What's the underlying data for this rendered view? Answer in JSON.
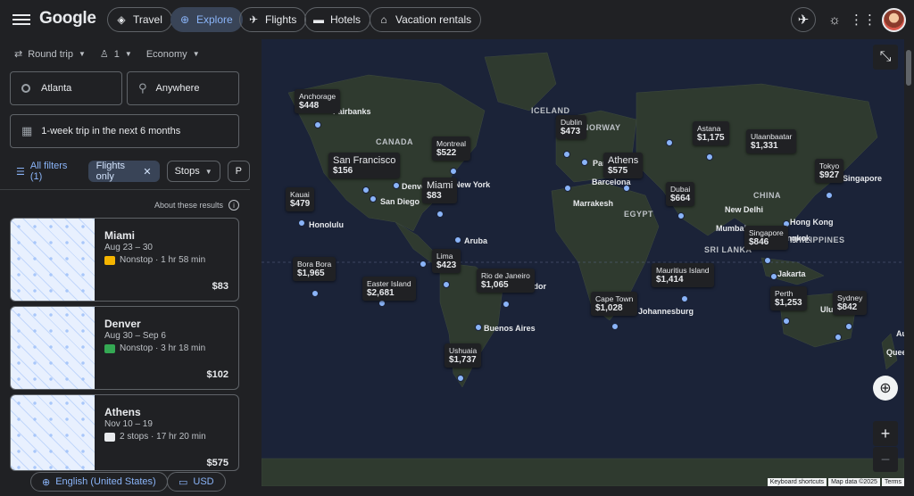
{
  "header": {
    "logo": "Google",
    "nav": [
      {
        "label": "Travel",
        "icon": "travel-icon"
      },
      {
        "label": "Explore",
        "icon": "explore-icon",
        "active": true
      },
      {
        "label": "Flights",
        "icon": "flights-icon"
      },
      {
        "label": "Hotels",
        "icon": "hotels-icon"
      },
      {
        "label": "Vacation rentals",
        "icon": "vacation-rentals-icon"
      }
    ]
  },
  "search": {
    "trip_type": "Round trip",
    "passengers": "1",
    "cabin": "Economy",
    "origin": "Atlanta",
    "destination": "Anywhere",
    "dates": "1-week trip in the next 6 months"
  },
  "filters": {
    "all": "All filters (1)",
    "flights_only": "Flights only",
    "stops": "Stops",
    "more": "P"
  },
  "about": "About these results",
  "results": [
    {
      "dest": "Miami",
      "dates": "Aug 23 – 30",
      "stops": "Nonstop · 1 hr 58 min",
      "price": "$83",
      "airline_color": "#f4b400"
    },
    {
      "dest": "Denver",
      "dates": "Aug 30 – Sep 6",
      "stops": "Nonstop · 3 hr 18 min",
      "price": "$102",
      "airline_color": "#34a853"
    },
    {
      "dest": "Athens",
      "dates": "Nov 10 – 19",
      "stops": "2 stops · 17 hr 20 min",
      "price": "$575",
      "airline_color": "#e8eaed"
    }
  ],
  "footer": {
    "language": "English (United States)",
    "currency": "USD"
  },
  "map": {
    "regions": [
      "CANADA",
      "ICELAND",
      "NORWAY",
      "EGYPT",
      "CHINA",
      "SRI LANKA",
      "PHILIPPINES"
    ],
    "cities": [
      "Fairbanks",
      "San Diego",
      "Denver",
      "New York",
      "Honolulu",
      "Aruba",
      "Ecuador",
      "Buenos Aires",
      "Paris",
      "Barcelona",
      "Marrakesh",
      "New Delhi",
      "Mumbai",
      "Hong Kong",
      "Bangkok",
      "Singapore",
      "Jakarta",
      "Johannesburg",
      "Uluru",
      "Auckland",
      "Queenstown"
    ],
    "prices": [
      {
        "name": "Anchorage",
        "price": "$448"
      },
      {
        "name": "San Francisco",
        "price": "$156"
      },
      {
        "name": "Montreal",
        "price": "$522"
      },
      {
        "name": "Miami",
        "price": "$83"
      },
      {
        "name": "Kauai",
        "price": "$479"
      },
      {
        "name": "Bora Bora",
        "price": "$1,965"
      },
      {
        "name": "Easter Island",
        "price": "$2,681"
      },
      {
        "name": "Lima",
        "price": "$423"
      },
      {
        "name": "Rio de Janeiro",
        "price": "$1,065"
      },
      {
        "name": "Ushuaia",
        "price": "$1,737"
      },
      {
        "name": "Dublin",
        "price": "$473"
      },
      {
        "name": "Athens",
        "price": "$575"
      },
      {
        "name": "Astana",
        "price": "$1,175"
      },
      {
        "name": "Ulaanbaatar",
        "price": "$1,331"
      },
      {
        "name": "Tokyo",
        "price": "$927"
      },
      {
        "name": "Dubai",
        "price": "$664"
      },
      {
        "name": "Mauritius Island",
        "price": "$1,414"
      },
      {
        "name": "Cape Town",
        "price": "$1,028"
      },
      {
        "name": "Singapore",
        "price": "$846"
      },
      {
        "name": "Perth",
        "price": "$1,253"
      },
      {
        "name": "Sydney",
        "price": "$842"
      }
    ],
    "attribution": [
      "Keyboard shortcuts",
      "Map data ©2025",
      "Terms"
    ]
  }
}
